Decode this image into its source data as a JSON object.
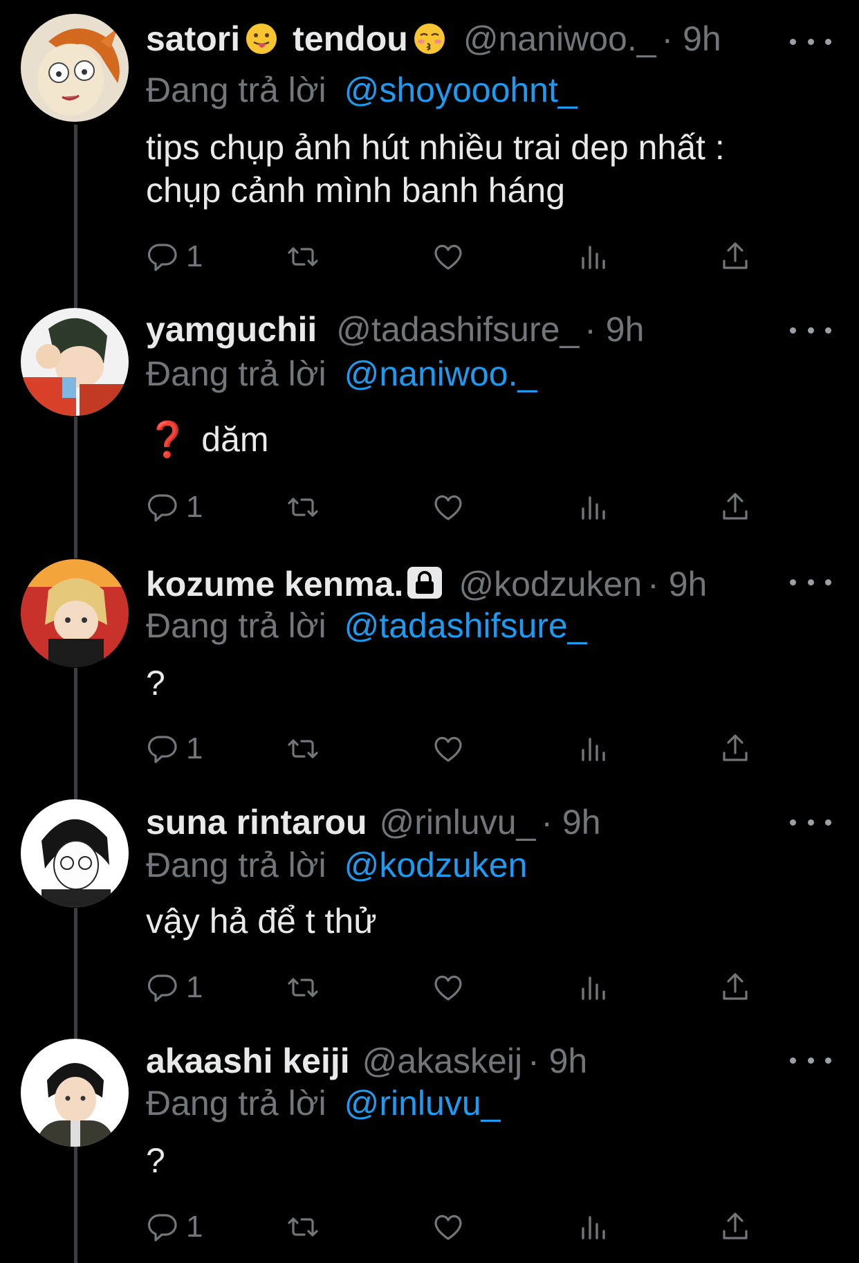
{
  "theme": {
    "background": "#000000",
    "text": "#e7e9ea",
    "muted": "#71767b",
    "accent": "#1d9bf0",
    "thread_line": "#3a3d40"
  },
  "tweets": [
    {
      "display_name_1": "satori",
      "emoji_1": "tongue-out-face",
      "display_name_2": "tendou",
      "emoji_2": "kissing-face",
      "handle": "@naniwoo._",
      "time": "· 9h",
      "reply_label": "Đang trả lời",
      "reply_to": "@shoyooohnt_",
      "text_line_1": "tips chụp ảnh hút nhiều trai dep nhất :",
      "text_line_2": "chụp cảnh mình banh háng",
      "reply_count": "1"
    },
    {
      "display_name": "yamguchii",
      "handle": "@tadashifsure_",
      "time": "· 9h",
      "reply_label": "Đang trả lời",
      "reply_to": "@naniwoo._",
      "text_prefix": "❓",
      "text": "dăm",
      "reply_count": "1"
    },
    {
      "display_name": "kozume kenma.",
      "badge": "lock-icon",
      "handle": "@kodzuken",
      "time": "· 9h",
      "reply_label": "Đang trả lời",
      "reply_to": "@tadashifsure_",
      "text": "?",
      "reply_count": "1"
    },
    {
      "display_name": "suna rintarou",
      "handle": "@rinluvu_",
      "time": "· 9h",
      "reply_label": "Đang trả lời",
      "reply_to": "@kodzuken",
      "text": "vậy hả để t thử",
      "reply_count": "1"
    },
    {
      "display_name": "akaashi keiji",
      "handle": "@akaskeij",
      "time": "· 9h",
      "reply_label": "Đang trả lời",
      "reply_to": "@rinluvu_",
      "text": "?",
      "reply_count": "1"
    }
  ]
}
